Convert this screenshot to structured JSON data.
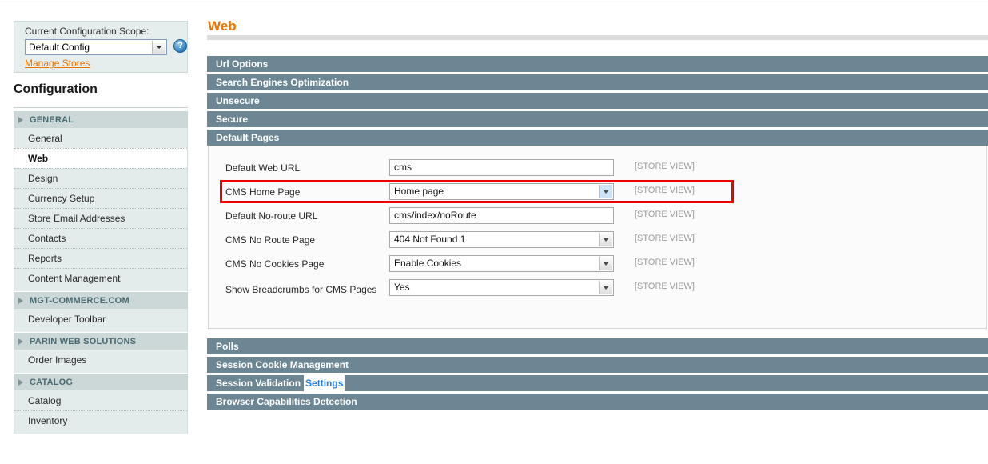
{
  "scope": {
    "label": "Current Configuration Scope:",
    "selected": "Default Config",
    "manage_stores_link": "Manage Stores",
    "help_icon": "help-icon",
    "dropdown_icon": "chevron-down-icon"
  },
  "sidebar": {
    "title": "Configuration",
    "groups": [
      {
        "heading": "GENERAL",
        "items": [
          {
            "label": "General",
            "active": false
          },
          {
            "label": "Web",
            "active": true
          },
          {
            "label": "Design",
            "active": false
          },
          {
            "label": "Currency Setup",
            "active": false
          },
          {
            "label": "Store Email Addresses",
            "active": false
          },
          {
            "label": "Contacts",
            "active": false
          },
          {
            "label": "Reports",
            "active": false
          },
          {
            "label": "Content Management",
            "active": false
          }
        ]
      },
      {
        "heading": "MGT-COMMERCE.COM",
        "items": [
          {
            "label": "Developer Toolbar",
            "active": false
          }
        ]
      },
      {
        "heading": "PARIN WEB SOLUTIONS",
        "items": [
          {
            "label": "Order Images",
            "active": false
          }
        ]
      },
      {
        "heading": "CATALOG",
        "items": [
          {
            "label": "Catalog",
            "active": false
          },
          {
            "label": "Inventory",
            "active": false
          }
        ]
      }
    ]
  },
  "main": {
    "page_title": "Web",
    "accent_color": "#ea7601",
    "section_color": "#6c8793",
    "highlight_color": "#ee0000",
    "sections_top": [
      {
        "label": "Url Options"
      },
      {
        "label": "Search Engines Optimization"
      },
      {
        "label": "Unsecure"
      },
      {
        "label": "Secure"
      },
      {
        "label": "Default Pages"
      }
    ],
    "sections_bottom": [
      {
        "label": "Polls",
        "chip": null
      },
      {
        "label": "Session Cookie Management",
        "chip": null
      },
      {
        "label": "Session Validation",
        "chip": "Settings"
      },
      {
        "label": "Browser Capabilities Detection",
        "chip": null
      }
    ],
    "default_pages_fields": [
      {
        "label": "Default Web URL",
        "type": "text",
        "value": "cms",
        "scope": "[STORE VIEW]",
        "highlighted": false,
        "focused": false
      },
      {
        "label": "CMS Home Page",
        "type": "select",
        "value": "Home page",
        "scope": "[STORE VIEW]",
        "highlighted": true,
        "focused": true
      },
      {
        "label": "Default No-route URL",
        "type": "text",
        "value": "cms/index/noRoute",
        "scope": "[STORE VIEW]",
        "highlighted": false,
        "focused": false
      },
      {
        "label": "CMS No Route Page",
        "type": "select",
        "value": "404 Not Found 1",
        "scope": "[STORE VIEW]",
        "highlighted": false,
        "focused": false
      },
      {
        "label": "CMS No Cookies Page",
        "type": "select",
        "value": "Enable Cookies",
        "scope": "[STORE VIEW]",
        "highlighted": false,
        "focused": false
      },
      {
        "label": "Show Breadcrumbs for CMS Pages",
        "type": "select",
        "value": "Yes",
        "scope": "[STORE VIEW]",
        "highlighted": false,
        "focused": false
      }
    ]
  }
}
